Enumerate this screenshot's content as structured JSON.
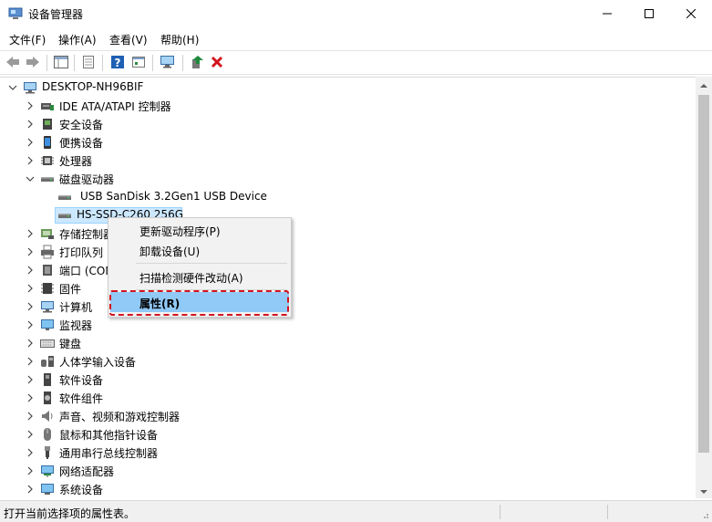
{
  "window": {
    "title": "设备管理器",
    "minimize_icon": "minimize-icon",
    "maximize_icon": "maximize-icon",
    "close_icon": "close-icon"
  },
  "menubar": {
    "file": "文件(F)",
    "action": "操作(A)",
    "view": "查看(V)",
    "help": "帮助(H)"
  },
  "toolbar": {
    "icons": [
      "back-arrow-icon",
      "forward-arrow-icon",
      "properties-grid-icon",
      "device-list-icon",
      "help-icon",
      "resources-icon",
      "monitor-scan-icon",
      "update-driver-icon",
      "uninstall-x-icon"
    ],
    "accent_green": "#1e8a3a",
    "accent_red": "#d2141f",
    "accent_blue": "#1565c0"
  },
  "tree": {
    "root": "DESKTOP-NH96BIF",
    "categories": [
      {
        "label": "IDE ATA/ATAPI 控制器",
        "icon": "ide-controller-icon"
      },
      {
        "label": "安全设备",
        "icon": "security-device-icon"
      },
      {
        "label": "便携设备",
        "icon": "portable-device-icon"
      },
      {
        "label": "处理器",
        "icon": "processor-icon"
      },
      {
        "label": "磁盘驱动器",
        "icon": "disk-drive-icon"
      },
      {
        "label": "USB  SanDisk 3.2Gen1 USB Device",
        "icon": "disk-icon"
      },
      {
        "label": "HS-SSD-C260 256G",
        "icon": "disk-icon"
      },
      {
        "label": "存储控制器",
        "icon": "storage-controller-icon"
      },
      {
        "label": "打印队列",
        "icon": "print-queue-icon"
      },
      {
        "label": "端口 (COM 和 LPT)",
        "icon": "port-icon"
      },
      {
        "label": "固件",
        "icon": "firmware-icon"
      },
      {
        "label": "计算机",
        "icon": "computer-icon"
      },
      {
        "label": "监视器",
        "icon": "monitor-icon"
      },
      {
        "label": "键盘",
        "icon": "keyboard-icon"
      },
      {
        "label": "人体学输入设备",
        "icon": "hid-icon"
      },
      {
        "label": "软件设备",
        "icon": "software-device-icon"
      },
      {
        "label": "软件组件",
        "icon": "software-component-icon"
      },
      {
        "label": "声音、视频和游戏控制器",
        "icon": "speaker-icon"
      },
      {
        "label": "鼠标和其他指针设备",
        "icon": "mouse-icon"
      },
      {
        "label": "通用串行总线控制器",
        "icon": "usb-icon"
      },
      {
        "label": "网络适配器",
        "icon": "network-adapter-icon"
      },
      {
        "label": "系统设备",
        "icon": "system-device-icon"
      }
    ]
  },
  "context_menu": {
    "update_driver": "更新驱动程序(P)",
    "uninstall_device": "卸载设备(U)",
    "scan_hardware": "扫描检测硬件改动(A)",
    "properties": "属性(R)"
  },
  "status": {
    "text": "打开当前选择项的属性表。"
  }
}
